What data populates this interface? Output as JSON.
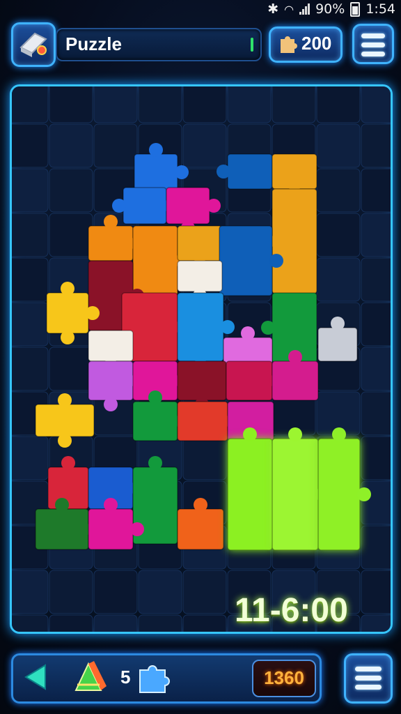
{
  "status_bar": {
    "battery": "90%",
    "time": "1:54"
  },
  "header": {
    "title": "Puzzle",
    "coins": "200"
  },
  "board": {
    "timer": "11-6:00"
  },
  "footer": {
    "hint_count": "5",
    "score": "1360"
  },
  "icons": {
    "tool": "eraser-icon",
    "coin": "puzzle-piece-icon",
    "menu": "hamburger-menu-icon",
    "back": "triangle-left-icon",
    "hint": "prism-icon"
  },
  "colors": {
    "accent": "#36c6ff",
    "timer_glow": "#b4ff4a",
    "score": "#ffb23d"
  }
}
